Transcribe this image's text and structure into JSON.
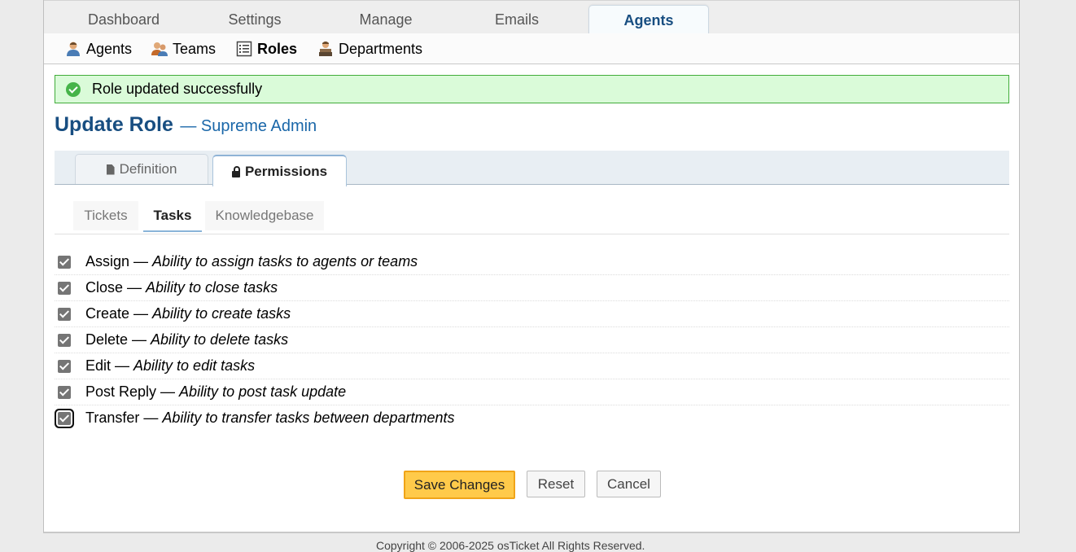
{
  "nav": {
    "tabs": [
      {
        "label": "Dashboard"
      },
      {
        "label": "Settings"
      },
      {
        "label": "Manage"
      },
      {
        "label": "Emails"
      },
      {
        "label": "Agents",
        "active": true
      }
    ]
  },
  "subnav": {
    "items": [
      {
        "label": "Agents",
        "icon": "agent-icon"
      },
      {
        "label": "Teams",
        "icon": "team-icon"
      },
      {
        "label": "Roles",
        "icon": "roles-list-icon",
        "active": true
      },
      {
        "label": "Departments",
        "icon": "department-icon"
      }
    ]
  },
  "banner": {
    "message": "Role updated successfully",
    "color": "#dafbd9",
    "border": "#41ac3a"
  },
  "heading": {
    "title": "Update Role",
    "subtitle": "— Supreme Admin"
  },
  "tabs": [
    {
      "label": "Definition",
      "icon": "document-icon"
    },
    {
      "label": "Permissions",
      "icon": "lock-icon",
      "active": true
    }
  ],
  "subtabs": [
    {
      "label": "Tickets"
    },
    {
      "label": "Tasks",
      "active": true
    },
    {
      "label": "Knowledgebase"
    }
  ],
  "permissions": [
    {
      "name": "Assign",
      "description": "Ability to assign tasks to agents or teams",
      "checked": true
    },
    {
      "name": "Close",
      "description": "Ability to close tasks",
      "checked": true
    },
    {
      "name": "Create",
      "description": "Ability to create tasks",
      "checked": true
    },
    {
      "name": "Delete",
      "description": "Ability to delete tasks",
      "checked": true
    },
    {
      "name": "Edit",
      "description": "Ability to edit tasks",
      "checked": true
    },
    {
      "name": "Post Reply",
      "description": "Ability to post task update",
      "checked": true
    },
    {
      "name": "Transfer",
      "description": "Ability to transfer tasks between departments",
      "checked": true
    }
  ],
  "separator": "—",
  "buttons": {
    "save": "Save Changes",
    "reset": "Reset",
    "cancel": "Cancel"
  },
  "footer": "Copyright © 2006-2025 osTicket All Rights Reserved.",
  "colors": {
    "accent": "#184e81",
    "link": "#1a67a9",
    "save_button": "#ffca4a"
  }
}
